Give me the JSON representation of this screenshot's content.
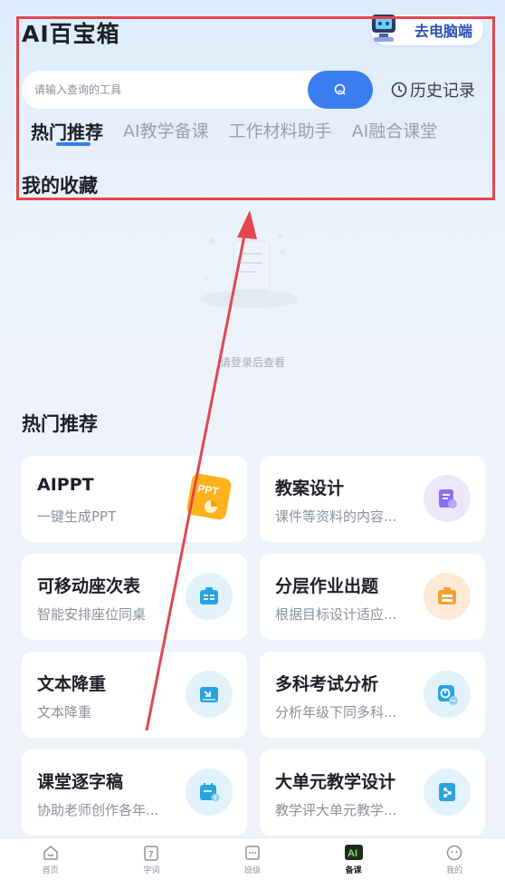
{
  "header": {
    "title": "AI百宝箱",
    "pc_button_label": "去电脑端"
  },
  "search": {
    "placeholder": "请输入查询的工具",
    "history_label": "历史记录"
  },
  "tabs": [
    {
      "label": "热门推荐",
      "active": true
    },
    {
      "label": "AI教学备课",
      "active": false
    },
    {
      "label": "工作材料助手",
      "active": false
    },
    {
      "label": "AI融合课堂",
      "active": false
    }
  ],
  "favorites": {
    "title": "我的收藏",
    "empty_text": "请登录后查看"
  },
  "hot": {
    "title": "热门推荐",
    "cards": [
      {
        "title": "AIPPT",
        "desc": "一键生成PPT",
        "icon": "ppt-icon"
      },
      {
        "title": "教案设计",
        "desc": "课件等资料的内容...",
        "icon": "lesson-plan-icon"
      },
      {
        "title": "可移动座次表",
        "desc": "智能安排座位同桌",
        "icon": "seating-chart-icon"
      },
      {
        "title": "分层作业出题",
        "desc": "根据目标设计适应...",
        "icon": "layered-homework-icon"
      },
      {
        "title": "文本降重",
        "desc": "文本降重",
        "icon": "text-rewrite-icon"
      },
      {
        "title": "多科考试分析",
        "desc": "分析年级下同多科...",
        "icon": "exam-analysis-icon"
      },
      {
        "title": "课堂逐字稿",
        "desc": "协助老师创作各年...",
        "icon": "transcript-icon"
      },
      {
        "title": "大单元教学设计",
        "desc": "教学评大单元教学...",
        "icon": "unit-design-icon"
      }
    ]
  },
  "tabbar": [
    {
      "label": "首页",
      "icon": "home-icon",
      "active": false
    },
    {
      "label": "字词",
      "icon": "calendar-7-icon",
      "active": false
    },
    {
      "label": "班级",
      "icon": "class-icon",
      "active": false
    },
    {
      "label": "备课",
      "icon": "prepare-lesson-icon",
      "active": true
    },
    {
      "label": "我的",
      "icon": "profile-icon",
      "active": false
    }
  ],
  "colors": {
    "accent": "#3b7cf0",
    "annotation": "#e2474f"
  }
}
